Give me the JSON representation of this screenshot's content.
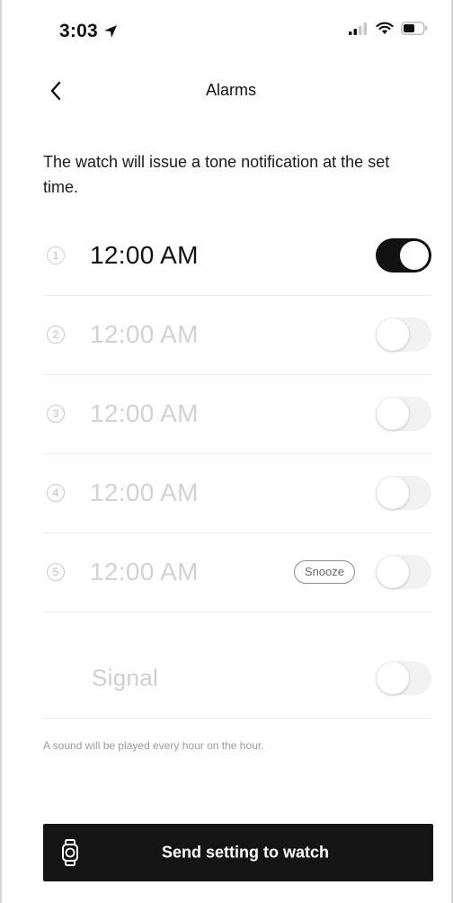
{
  "status_bar": {
    "time": "3:03",
    "location_icon": "location-arrow-icon",
    "signal_icon": "cellular-signal-icon",
    "wifi_icon": "wifi-icon",
    "battery_icon": "battery-icon"
  },
  "nav": {
    "back_icon": "chevron-left-icon",
    "title": "Alarms"
  },
  "description": "The watch will issue a tone notification at the set time.",
  "alarms": [
    {
      "index": "1",
      "time": "12:00 AM",
      "enabled": true
    },
    {
      "index": "2",
      "time": "12:00 AM",
      "enabled": false
    },
    {
      "index": "3",
      "time": "12:00 AM",
      "enabled": false
    },
    {
      "index": "4",
      "time": "12:00 AM",
      "enabled": false
    },
    {
      "index": "5",
      "time": "12:00 AM",
      "enabled": false,
      "snooze_label": "Snooze"
    }
  ],
  "signal": {
    "label": "Signal",
    "enabled": false,
    "note": "A sound will be played every hour on the hour."
  },
  "send_button": {
    "icon": "watch-icon",
    "label": "Send setting to watch"
  },
  "colors": {
    "accent": "#141414",
    "toggle_off": "#f2f2f2",
    "disabled_text": "#d2d2d2"
  }
}
